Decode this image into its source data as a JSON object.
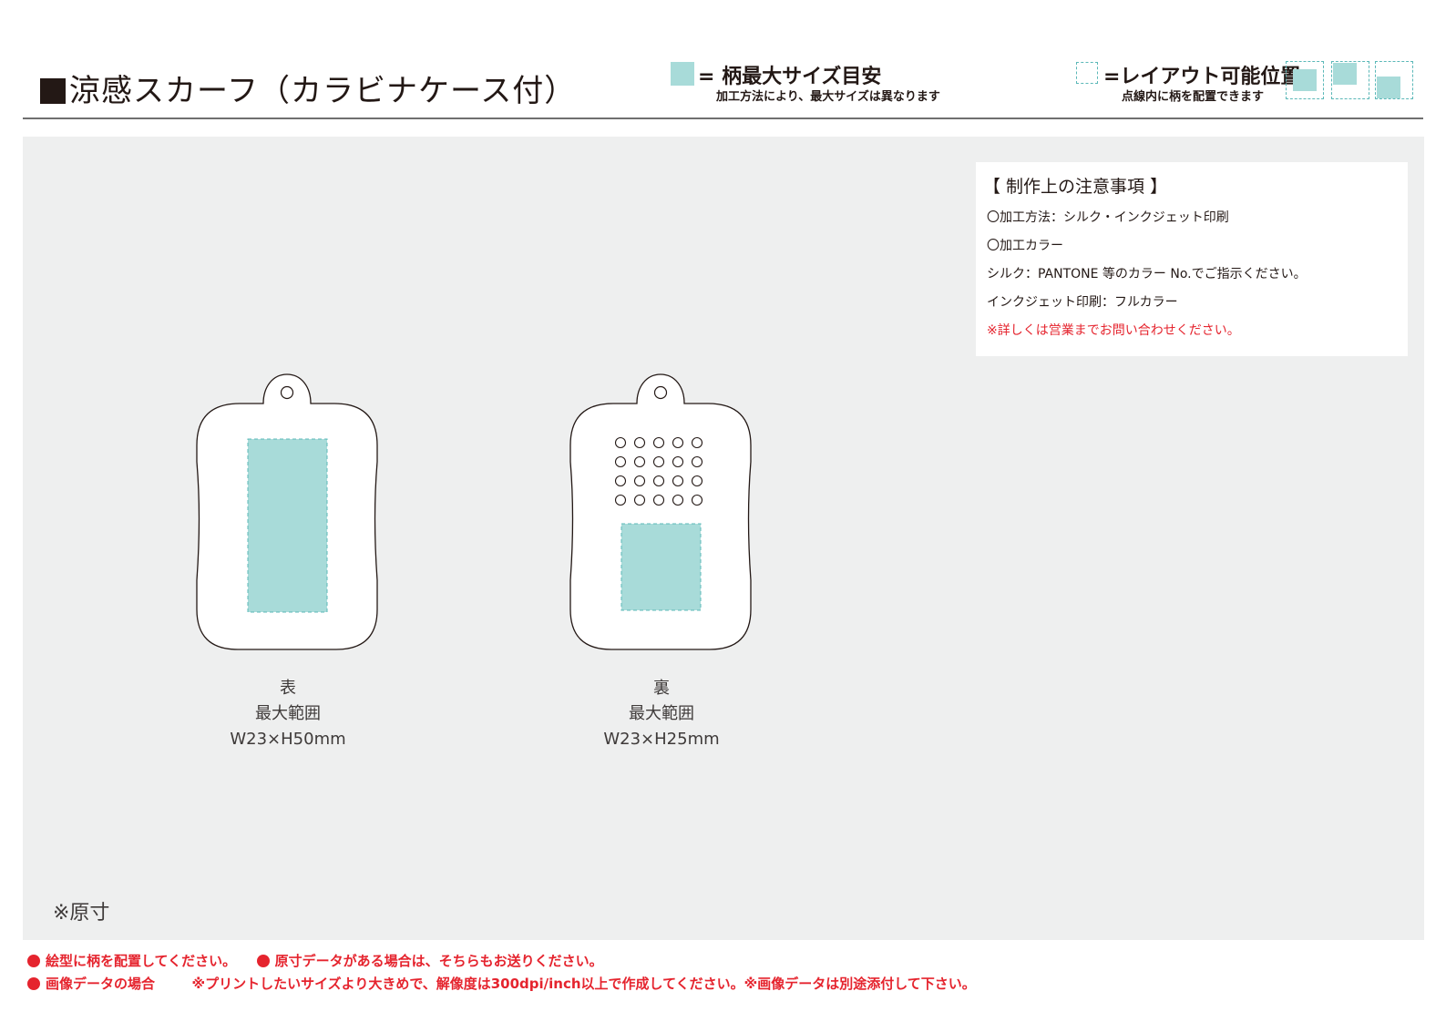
{
  "header": {
    "title": "涼感スカーフ（カラビナケース付）",
    "legend_max": {
      "label": "= 柄最大サイズ目安",
      "note": "加工方法により、最大サイズは異なります",
      "swatch_color": "#a8dbd9"
    },
    "legend_layout": {
      "label": "=レイアウト可能位置",
      "note": "点線内に柄を配置できます",
      "border_color": "#5bb8b8"
    }
  },
  "notes": {
    "heading": "【 制作上の注意事項 】",
    "lines": [
      "〇加工方法：シルク・インクジェット印刷",
      "〇加工カラー",
      "シルク：PANTONE 等のカラー No.でご指示ください。",
      "インクジェット印刷：フルカラー"
    ],
    "warning": "※詳しくは営業までお問い合わせください。"
  },
  "front": {
    "side": "表",
    "range_label": "最大範囲",
    "size": "W23×H50mm"
  },
  "back": {
    "side": "裏",
    "range_label": "最大範囲",
    "size": "W23×H25mm"
  },
  "scale_note": "※原寸",
  "footer": {
    "note1": "絵型に柄を配置してください。",
    "note2": "原寸データがある場合は、そちらもお送りください。",
    "note3_label": "画像データの場合",
    "note3_text": "※プリントしたいサイズより大きめで、解像度は300dpi/inch以上で作成してください。※画像データは別途添付して下さい。"
  },
  "colors": {
    "accent_fill": "#a8dbd9",
    "dash": "#5bb8b8",
    "warning_red": "#e5242e",
    "canvas_bg": "#eeefef"
  }
}
